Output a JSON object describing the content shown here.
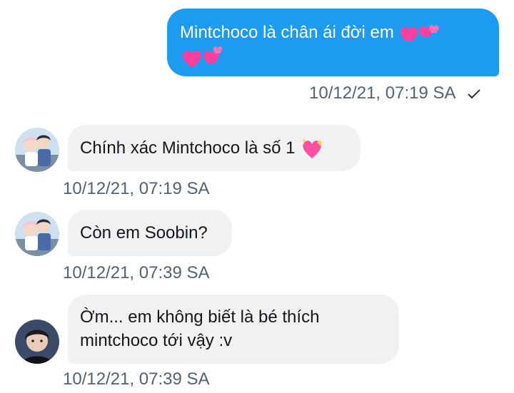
{
  "messages": [
    {
      "direction": "outgoing",
      "text": "Mintchoco là chân ái đời em",
      "emoji": [
        "two-hearts",
        "two-hearts",
        "two-hearts",
        "two-hearts"
      ],
      "timestamp": "10/12/21, 07:19 SA",
      "status_icon": "check-icon"
    },
    {
      "direction": "incoming",
      "avatar": "avatar-anime-pair",
      "text": "Chính xác Mintchoco là số 1",
      "emoji": [
        "sparkling-heart"
      ],
      "timestamp": "10/12/21, 07:19 SA"
    },
    {
      "direction": "incoming",
      "avatar": "avatar-anime-pair",
      "text": "Còn em Soobin?",
      "timestamp": "10/12/21, 07:39 SA"
    },
    {
      "direction": "incoming",
      "avatar": "avatar-person",
      "text_line1": "Ờm... em không biết là bé thích",
      "text_line2": "mintchoco tới vậy :v",
      "timestamp": "10/12/21, 07:39 SA"
    }
  ],
  "colors": {
    "outgoing_bubble": "#1d9bf0",
    "incoming_bubble": "#eff1f3",
    "timestamp_text": "#546270"
  }
}
